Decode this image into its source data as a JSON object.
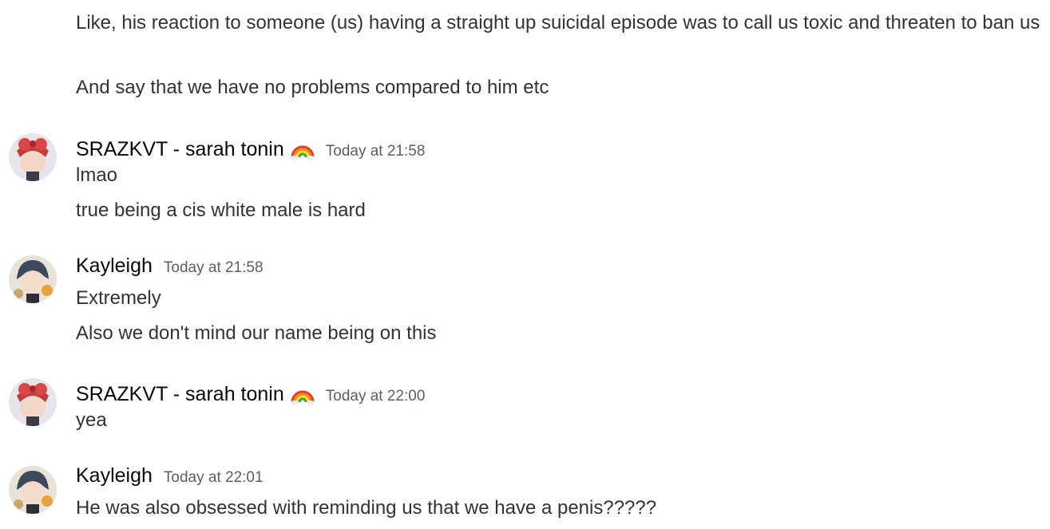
{
  "messages_top": {
    "line1": "Like, his reaction to someone (us) having a straight up suicidal episode was to call us toxic and threaten to ban us",
    "line2": "And say that we have no problems compared to him etc"
  },
  "groups": [
    {
      "username": "SRAZKVT - sarah tonin",
      "emoji": "rainbow-emoji",
      "timestamp": "Today at 21:58",
      "lines": [
        "lmao",
        "true being a cis white male is hard"
      ]
    },
    {
      "username": "Kayleigh",
      "timestamp": "Today at 21:58",
      "lines": [
        "Extremely",
        "Also we don't mind our name being on this"
      ]
    },
    {
      "username": "SRAZKVT - sarah tonin",
      "emoji": "rainbow-emoji",
      "timestamp": "Today at 22:00",
      "lines": [
        "yea"
      ]
    },
    {
      "username": "Kayleigh",
      "timestamp": "Today at 22:01",
      "lines": [
        "He was also obsessed with reminding us that we have a penis?????"
      ]
    }
  ],
  "colors": {
    "text": "#313338",
    "username": "#060607",
    "timestamp": "#5c5e66"
  }
}
